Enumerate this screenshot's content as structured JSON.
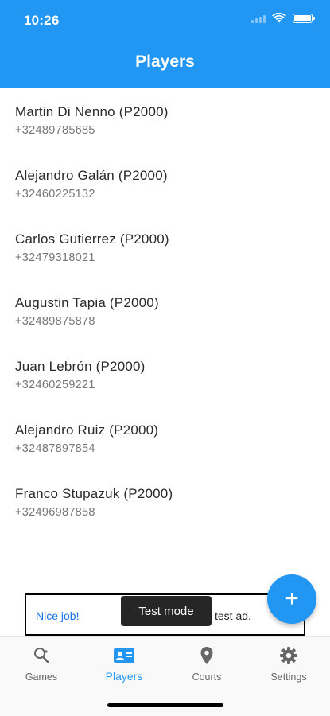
{
  "status_bar": {
    "time": "10:26"
  },
  "header": {
    "title": "Players"
  },
  "players": [
    {
      "name": "Martin Di Nenno (P2000)",
      "phone": "+32489785685"
    },
    {
      "name": "Alejandro Galán (P2000)",
      "phone": "+32460225132"
    },
    {
      "name": "Carlos Gutierrez (P2000)",
      "phone": "+32479318021"
    },
    {
      "name": "Augustin Tapia (P2000)",
      "phone": "+32489875878"
    },
    {
      "name": "Juan Lebrón (P2000)",
      "phone": "+32460259221"
    },
    {
      "name": "Alejandro Ruiz (P2000)",
      "phone": "+32487897854"
    },
    {
      "name": "Franco Stupazuk (P2000)",
      "phone": "+32496987858"
    }
  ],
  "fab": {
    "icon": "plus-icon",
    "label": "+"
  },
  "ad": {
    "left_text": "Nice job!",
    "right_text": "test ad.",
    "toast": "Test mode"
  },
  "nav": {
    "items": [
      {
        "label": "Games",
        "icon": "racket-icon"
      },
      {
        "label": "Players",
        "icon": "id-card-icon"
      },
      {
        "label": "Courts",
        "icon": "location-pin-icon"
      },
      {
        "label": "Settings",
        "icon": "gear-icon"
      }
    ],
    "active": "Players"
  },
  "colors": {
    "primary": "#2196F3",
    "text": "#2a2a2a",
    "subtext": "#777777"
  }
}
